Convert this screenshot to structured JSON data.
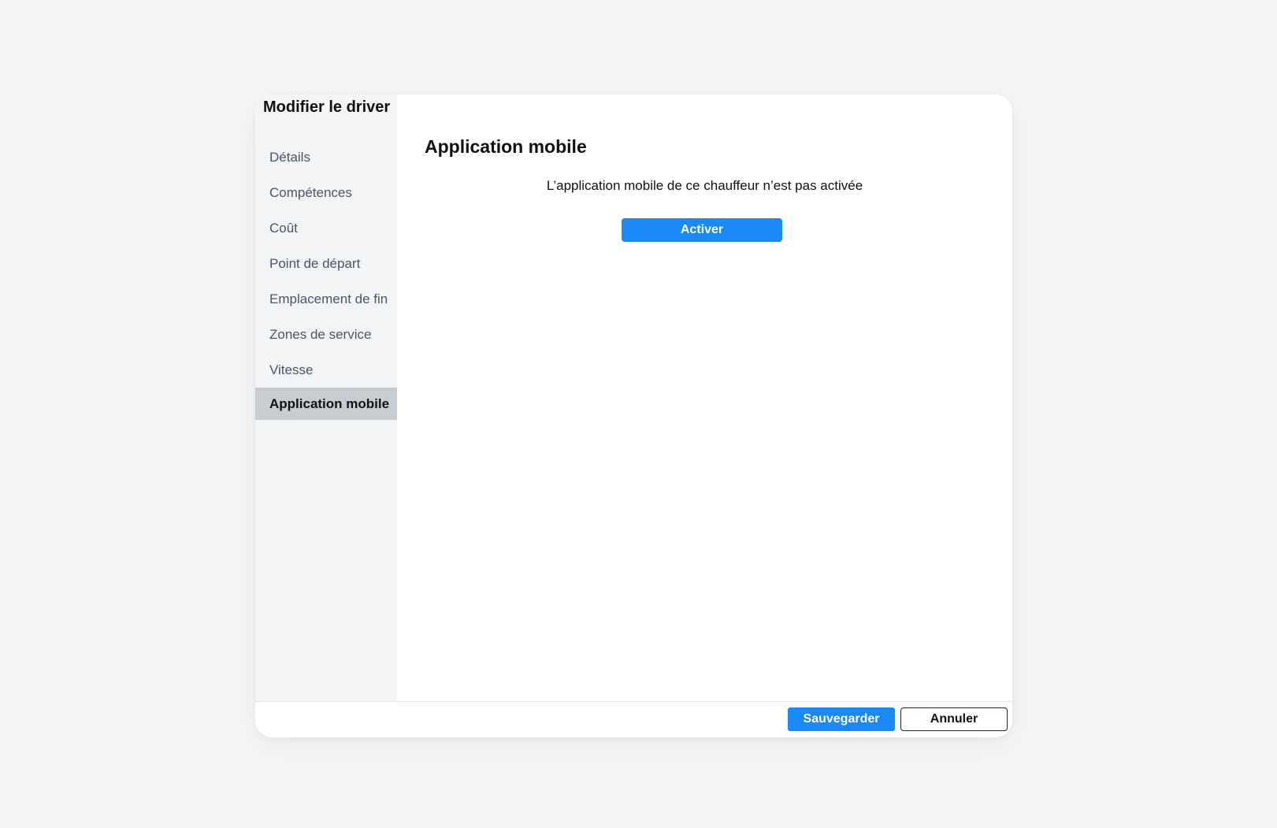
{
  "dialog": {
    "title": "Modifier le driver"
  },
  "sidebar": {
    "items": [
      {
        "label": "Détails"
      },
      {
        "label": "Compétences"
      },
      {
        "label": "Coût"
      },
      {
        "label": "Point de départ"
      },
      {
        "label": "Emplacement de fin"
      },
      {
        "label": "Zones de service"
      },
      {
        "label": "Vitesse"
      },
      {
        "label": "Application mobile",
        "active": true
      }
    ]
  },
  "main": {
    "title": "Application mobile",
    "status_text": "L’application mobile de ce chauffeur n’est pas activée",
    "activate_label": "Activer"
  },
  "footer": {
    "save_label": "Sauvegarder",
    "cancel_label": "Annuler"
  },
  "colors": {
    "accent": "#1a88f5",
    "sidebar_bg": "#f3f4f6",
    "active_item_bg": "#c7ccd3",
    "page_bg": "#f5f5f6"
  }
}
